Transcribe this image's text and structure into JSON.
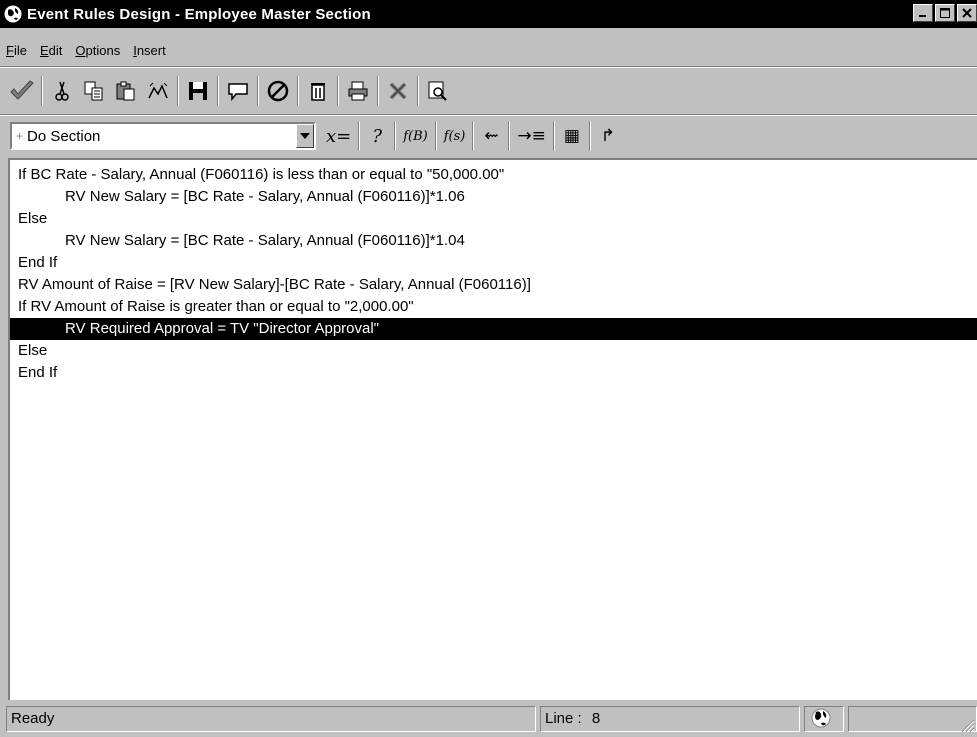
{
  "window": {
    "title": "Event Rules Design - Employee Master Section",
    "title_buttons": [
      "minimize-icon",
      "maximize-icon",
      "close-icon"
    ]
  },
  "menu": [
    {
      "label": "File",
      "mnemonic": "F",
      "rest": "ile"
    },
    {
      "label": "Edit",
      "mnemonic": "E",
      "rest": "dit"
    },
    {
      "label": "Options",
      "mnemonic": "O",
      "rest": "ptions"
    },
    {
      "label": "Insert",
      "mnemonic": "I",
      "rest": "nsert"
    }
  ],
  "toolbar1": {
    "icons": [
      "checkmark-icon",
      "cut-icon",
      "copy-icon",
      "paste-icon",
      "find-icon",
      "save-icon",
      "comment-icon",
      "disable-icon",
      "delete-icon",
      "print-icon",
      "cancel-icon",
      "search-icon"
    ]
  },
  "toolbar2": {
    "combo_value": "Do Section",
    "buttons": [
      {
        "name": "assignment-button",
        "glyph": "x="
      },
      {
        "name": "if-button",
        "glyph": "?"
      },
      {
        "name": "business-function-button",
        "glyph": "f(B)"
      },
      {
        "name": "system-function-button",
        "glyph": "f(s)"
      },
      {
        "name": "table-io-button",
        "glyph": "⇜"
      },
      {
        "name": "insert-line-button",
        "glyph": "→≡"
      },
      {
        "name": "table-button",
        "glyph": "▦"
      },
      {
        "name": "report-button",
        "glyph": "↱"
      }
    ]
  },
  "code": [
    {
      "text": "If BC Rate - Salary, Annual (F060116) is less than or equal to \"50,000.00\"",
      "indent": false,
      "selected": false
    },
    {
      "text": "RV New Salary = [BC Rate - Salary, Annual (F060116)]*1.06",
      "indent": true,
      "selected": false
    },
    {
      "text": "Else",
      "indent": false,
      "selected": false
    },
    {
      "text": "RV New Salary = [BC Rate - Salary, Annual (F060116)]*1.04",
      "indent": true,
      "selected": false
    },
    {
      "text": "End If",
      "indent": false,
      "selected": false
    },
    {
      "text": "RV Amount of Raise = [RV New Salary]-[BC Rate - Salary, Annual (F060116)]",
      "indent": false,
      "selected": false
    },
    {
      "text": "If RV Amount of Raise is greater than or equal to \"2,000.00\"",
      "indent": false,
      "selected": false
    },
    {
      "text": "RV Required Approval = TV \"Director Approval\"",
      "indent": true,
      "selected": true
    },
    {
      "text": "Else",
      "indent": false,
      "selected": false
    },
    {
      "text": "End If",
      "indent": false,
      "selected": false
    }
  ],
  "status": {
    "state": "Ready",
    "line_label": "Line :",
    "line_value": "8"
  }
}
